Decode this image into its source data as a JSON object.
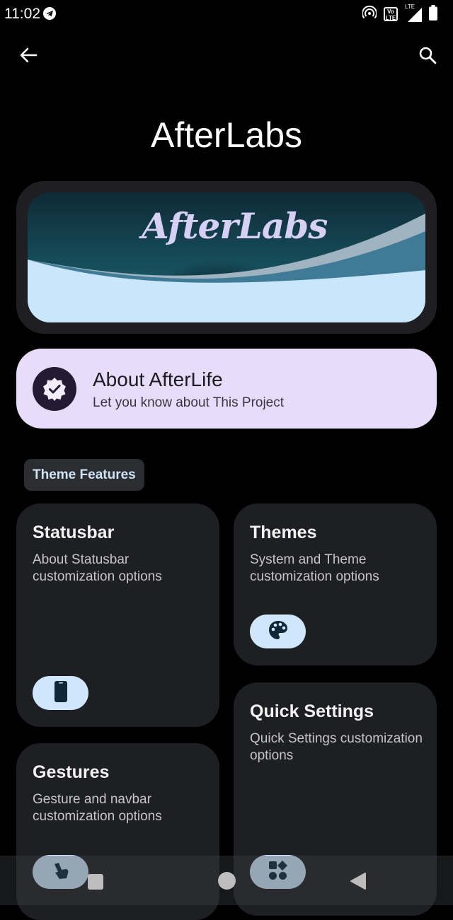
{
  "status_bar": {
    "time": "11:02",
    "volte_label": "Vo LTE",
    "lte_label": "LTE"
  },
  "toolbar": {
    "back_icon": "arrow-left-icon",
    "search_icon": "search-icon"
  },
  "page_title": "AfterLabs",
  "banner": {
    "logo_text": "AfterLabs"
  },
  "about_card": {
    "title": "About AfterLife",
    "subtitle": "Let you know about This Project",
    "icon": "verified-badge-icon"
  },
  "section_chip": "Theme Features",
  "features": [
    {
      "title": "Statusbar",
      "subtitle": "About Statusbar customization options",
      "icon": "phone-icon"
    },
    {
      "title": "Themes",
      "subtitle": "System and Theme customization options",
      "icon": "palette-icon"
    },
    {
      "title": "Quick Settings",
      "subtitle": "Quick Settings customization options",
      "icon": "widgets-icon"
    },
    {
      "title": "Gestures",
      "subtitle": "Gesture and navbar customization options",
      "icon": "gesture-icon"
    }
  ],
  "colors": {
    "background": "#000000",
    "card": "#1e1f22",
    "about_card": "#e8dcfb",
    "pill": "#cfe6fb",
    "chip_text": "#cfe3f7"
  }
}
